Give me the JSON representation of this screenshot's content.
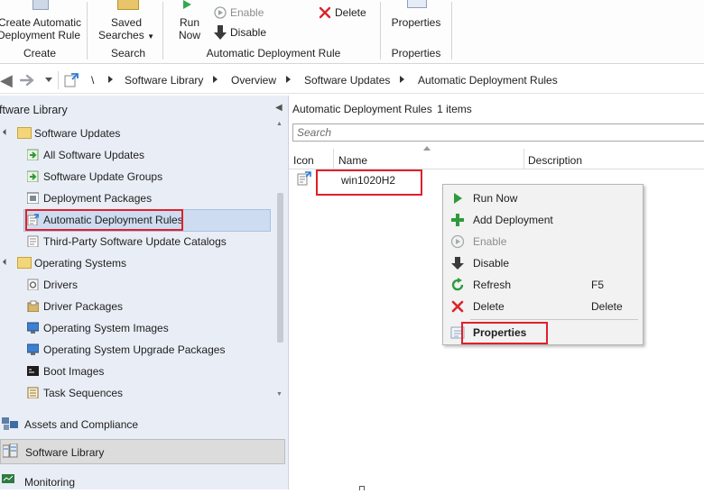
{
  "ribbon": {
    "create_rule_line1": "Create Automatic",
    "create_rule_line2": "Deployment Rule",
    "group_create": "Create",
    "saved_searches_line1": "Saved",
    "saved_searches_line2": "Searches",
    "group_search": "Search",
    "run_now_line1": "Run",
    "run_now_line2": "Now",
    "enable": "Enable",
    "disable": "Disable",
    "delete": "Delete",
    "group_adr": "Automatic Deployment Rule",
    "properties": "Properties",
    "group_properties": "Properties"
  },
  "breadcrumb": {
    "root": "\\",
    "items": [
      "Software Library",
      "Overview",
      "Software Updates",
      "Automatic Deployment Rules"
    ]
  },
  "left_pane": {
    "title": "ftware Library",
    "tree": [
      {
        "label": "Software Updates",
        "icon": "folder-icon"
      },
      {
        "label": "All Software Updates",
        "icon": "updates-icon"
      },
      {
        "label": "Software Update Groups",
        "icon": "update-group-icon"
      },
      {
        "label": "Deployment Packages",
        "icon": "package-icon"
      },
      {
        "label": "Automatic Deployment Rules",
        "icon": "rule-icon"
      },
      {
        "label": "Third-Party Software Update Catalogs",
        "icon": "catalog-icon"
      },
      {
        "label": "Operating Systems",
        "icon": "folder-icon"
      },
      {
        "label": "Drivers",
        "icon": "driver-icon"
      },
      {
        "label": "Driver Packages",
        "icon": "driver-package-icon"
      },
      {
        "label": "Operating System Images",
        "icon": "os-image-icon"
      },
      {
        "label": "Operating System Upgrade Packages",
        "icon": "os-upgrade-icon"
      },
      {
        "label": "Boot Images",
        "icon": "boot-image-icon"
      },
      {
        "label": "Task Sequences",
        "icon": "task-sequence-icon"
      }
    ],
    "workspaces": [
      "Assets and Compliance",
      "Software Library",
      "Monitoring"
    ]
  },
  "right_pane": {
    "title": "Automatic Deployment Rules",
    "count": "1 items",
    "search_placeholder": "Search",
    "columns": [
      "Icon",
      "Name",
      "Description"
    ],
    "rows": [
      {
        "name": "win1020H2",
        "description": ""
      }
    ]
  },
  "context_menu": {
    "items": [
      {
        "label": "Run Now",
        "shortcut": "",
        "icon": "run-icon",
        "disabled": false
      },
      {
        "label": "Add Deployment",
        "shortcut": "",
        "icon": "add-icon",
        "disabled": false
      },
      {
        "label": "Enable",
        "shortcut": "",
        "icon": "enable-icon",
        "disabled": true
      },
      {
        "label": "Disable",
        "shortcut": "",
        "icon": "disable-icon",
        "disabled": false
      },
      {
        "label": "Refresh",
        "shortcut": "F5",
        "icon": "refresh-icon",
        "disabled": false
      },
      {
        "label": "Delete",
        "shortcut": "Delete",
        "icon": "delete-icon",
        "disabled": false
      },
      {
        "label": "Properties",
        "shortcut": "",
        "icon": "properties-icon",
        "disabled": false
      }
    ]
  },
  "colors": {
    "highlight_red": "#e1202a",
    "selected_tree": "#cddcf0",
    "pane_bg": "#e9eef6"
  }
}
